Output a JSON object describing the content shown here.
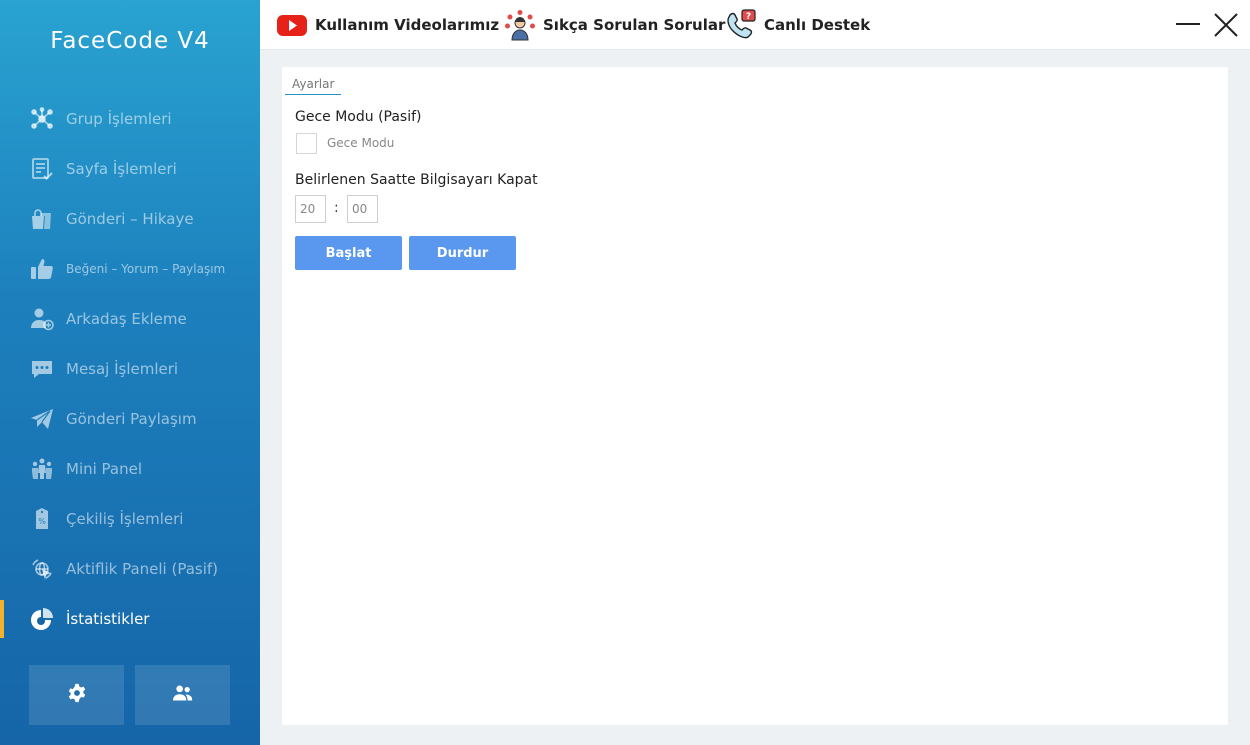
{
  "app": {
    "title": "FaceCode V4"
  },
  "sidebar": {
    "items": [
      {
        "label": "Grup İşlemleri",
        "icon": "network-icon"
      },
      {
        "label": "Sayfa İşlemleri",
        "icon": "document-check-icon"
      },
      {
        "label": "Gönderi – Hikaye",
        "icon": "shopping-bags-icon"
      },
      {
        "label": "Beğeni – Yorum – Paylaşım",
        "icon": "thumbs-up-icon"
      },
      {
        "label": "Arkadaş Ekleme",
        "icon": "add-user-icon"
      },
      {
        "label": "Mesaj İşlemleri",
        "icon": "chat-bubble-icon"
      },
      {
        "label": "Gönderi Paylaşım",
        "icon": "paper-plane-icon"
      },
      {
        "label": "Mini Panel",
        "icon": "group-icon"
      },
      {
        "label": "Çekiliş İşlemleri",
        "icon": "ticket-percent-icon"
      },
      {
        "label": "Aktiflik Paneli (Pasif)",
        "icon": "globe-cursor-icon"
      },
      {
        "label": "İstatistikler",
        "icon": "pie-chart-icon",
        "active": true
      }
    ],
    "bottom_buttons": [
      {
        "icon": "gear-icon"
      },
      {
        "icon": "users-icon"
      }
    ]
  },
  "topbar": {
    "links": [
      {
        "label": "Kullanım Videolarımız",
        "icon": "youtube-icon"
      },
      {
        "label": "Sıkça Sorulan Sorular",
        "icon": "faq-person-icon"
      },
      {
        "label": "Canlı Destek",
        "icon": "support-phone-icon"
      }
    ]
  },
  "settings": {
    "tab_label": "Ayarlar",
    "night_mode_title": "Gece Modu (Pasif)",
    "night_mode_checkbox_label": "Gece Modu",
    "shutdown_title": "Belirlenen Saatte Bilgisayarı Kapat",
    "hour_value": "20",
    "minute_value": "00",
    "separator": ":",
    "start_button": "Başlat",
    "stop_button": "Durdur"
  },
  "colors": {
    "sidebar_top": "#29a3d1",
    "sidebar_bottom": "#1565a8",
    "active_indicator": "#f4b22c",
    "button_blue": "#5a97ef",
    "youtube_red": "#e62117"
  }
}
